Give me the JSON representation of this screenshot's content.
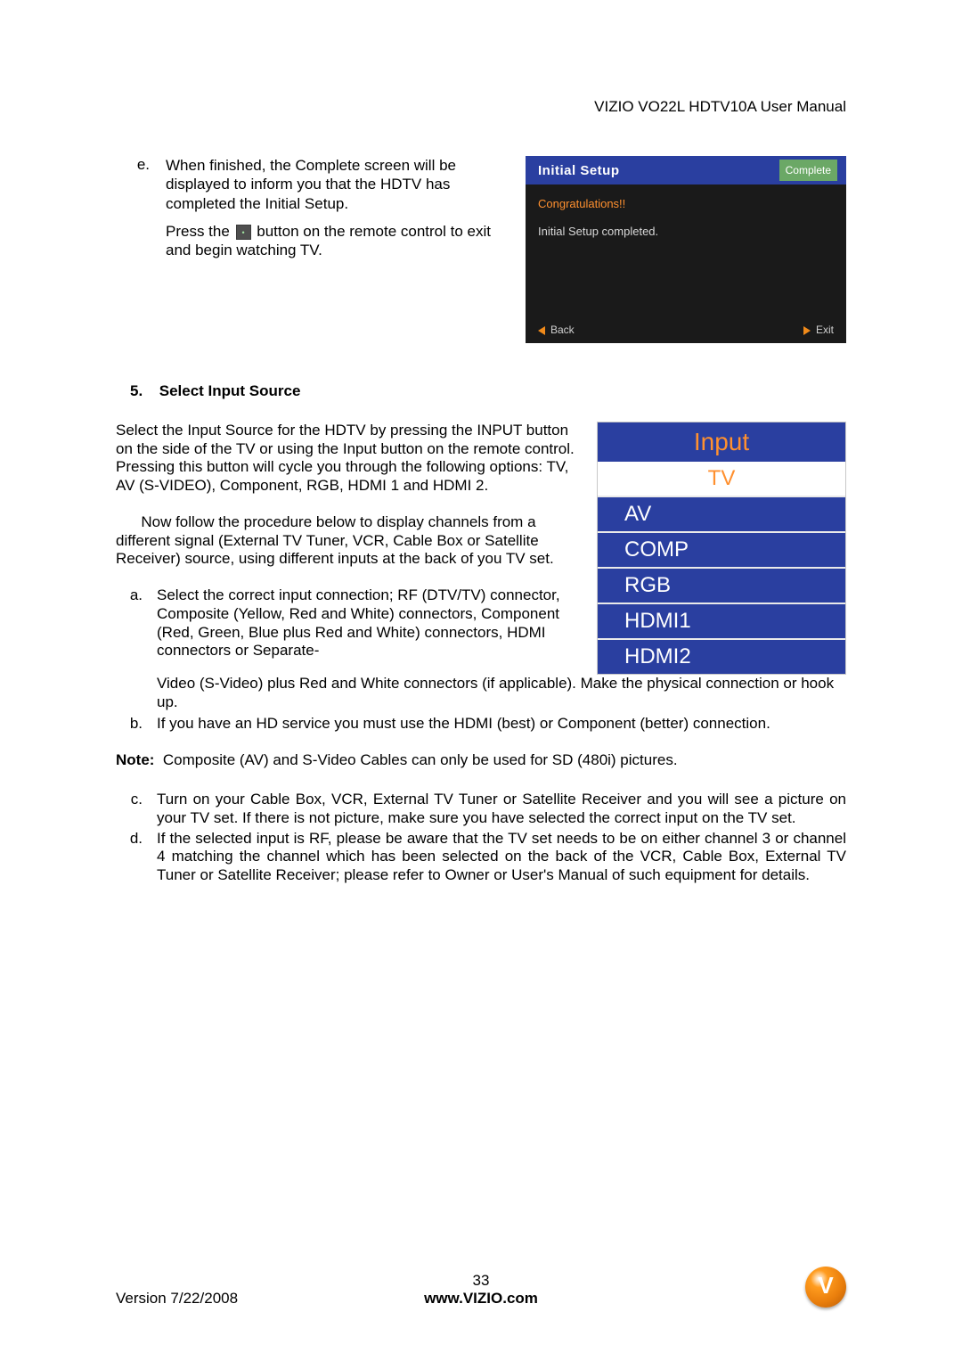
{
  "header": {
    "manual_title": "VIZIO VO22L HDTV10A User Manual"
  },
  "step_e": {
    "marker": "e.",
    "para1": "When finished, the Complete screen will be displayed to inform you that the HDTV has completed the Initial Setup.",
    "para2_prefix": "Press the ",
    "para2_suffix": " button on the remote control to exit and begin watching TV."
  },
  "osd_initial": {
    "title": "Initial  Setup",
    "badge": "Complete",
    "congrats": "Congratulations!!",
    "msg": "Initial Setup completed.",
    "back": "Back",
    "exit": "Exit"
  },
  "section5": {
    "number": "5.",
    "title": "Select Input Source",
    "p1": "Select the Input Source for the HDTV by pressing the INPUT button on the side of the TV or using the Input button on the remote control.  Pressing this button will cycle you through the following options: TV, AV (S-VIDEO), Component, RGB, HDMI 1 and HDMI 2.",
    "p2": "      Now follow the procedure below to display channels from a different signal (External TV Tuner, VCR, Cable Box or Satellite Receiver) source, using different inputs at the back of you TV set.",
    "item_a_marker": "a.",
    "item_a_lead": "Select the correct input connection; RF (DTV/TV) connector, Composite (Yellow, Red and White) connectors, Component (Red, Green, Blue plus Red and White) connectors, HDMI connectors or Separate-",
    "item_a_tail": "Video (S-Video) plus Red and White connectors (if applicable). Make the physical connection or hook up.",
    "item_b_marker": "b.",
    "item_b": "If you have an HD service you must use the HDMI (best) or Component (better) connection.",
    "note_label": "Note:",
    "note_text": "  Composite (AV) and S-Video Cables can only be used for SD (480i) pictures.",
    "item_c_marker": "c.",
    "item_c": "Turn on your Cable Box, VCR, External TV Tuner or Satellite Receiver and you will see a picture on your TV set. If there is not picture, make sure you have selected the correct input on the TV set.",
    "item_d_marker": "d.",
    "item_d": "If the selected input is RF, please be aware that the TV set needs to be on either channel 3 or channel 4 matching the channel which has been selected on the back of the VCR, Cable Box, External TV Tuner or Satellite Receiver; please refer to Owner or User's Manual of such equipment for details."
  },
  "input_menu": {
    "title": "Input",
    "items": [
      "TV",
      "AV",
      "COMP",
      "RGB",
      "HDMI1",
      "HDMI2"
    ],
    "selected_index": 0
  },
  "footer": {
    "version": "Version 7/22/2008",
    "page": "33",
    "url": "www.VIZIO.com"
  }
}
